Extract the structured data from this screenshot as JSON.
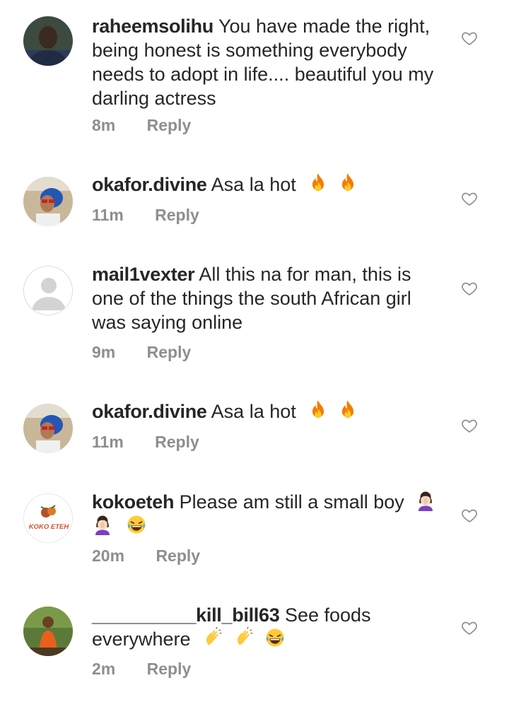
{
  "reply_label": "Reply",
  "comments": [
    {
      "username": "raheemsolihu",
      "text": "You have made the right, being honest is something everybody needs to adopt in life.... beautiful you my darling actress",
      "time": "8m",
      "avatar": "avatar-photo-dark"
    },
    {
      "username": "okafor.divine",
      "text": "Asa la hot",
      "time": "11m",
      "avatar": "avatar-photo-glasses",
      "emojis": [
        "fire-emoji",
        "fire-emoji"
      ]
    },
    {
      "username": "mail1vexter",
      "text": "All this na for man, this is one of the things the south African girl was saying online",
      "time": "9m",
      "avatar": "default-avatar"
    },
    {
      "username": "okafor.divine",
      "text": "Asa la hot",
      "time": "11m",
      "avatar": "avatar-photo-glasses",
      "emojis": [
        "fire-emoji",
        "fire-emoji"
      ]
    },
    {
      "username": "kokoeteh",
      "text": "Please am still a small boy",
      "time": "20m",
      "avatar": "koko-eteh-logo",
      "logo_text": "KOKO ETEH",
      "emojis": [
        "facepalm-emoji",
        "facepalm-emoji",
        "laughing-emoji"
      ]
    },
    {
      "username": "__________kill_bill63",
      "text": "See foods everywhere",
      "time": "2m",
      "avatar": "avatar-photo-outdoor",
      "emojis": [
        "clapping-emoji",
        "clapping-emoji",
        "laughing-emoji"
      ]
    }
  ],
  "colors": {
    "text": "#262626",
    "secondary": "#8e8e8e",
    "heart_outline": "#8e8e8e",
    "fire_orange": "#f57c00",
    "fire_yellow": "#ffca28",
    "emoji_yellow": "#ffcc33"
  }
}
